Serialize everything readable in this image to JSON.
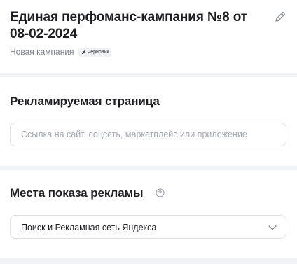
{
  "campaign": {
    "title": "Единая перфоманс-кампания №8 от 08-02-2024",
    "subtitle": "Новая кампания",
    "badge": "Черновик",
    "edit_icon": "pencil-icon"
  },
  "advertised_page": {
    "title": "Рекламируемая страница",
    "input_value": "",
    "input_placeholder": "Ссылка на сайт, соцсеть, маркетплейс или приложение"
  },
  "ad_placements": {
    "title": "Места показа рекламы",
    "help_icon": "question-circle-icon",
    "selected": "Поиск и Рекламная сеть Яндекса",
    "dropdown_icon": "chevron-down-icon"
  },
  "colors": {
    "background": "#f2f3f7",
    "card": "#ffffff",
    "text": "#1f1f23",
    "muted": "#7a7f8c",
    "border": "#dfe1e7"
  }
}
